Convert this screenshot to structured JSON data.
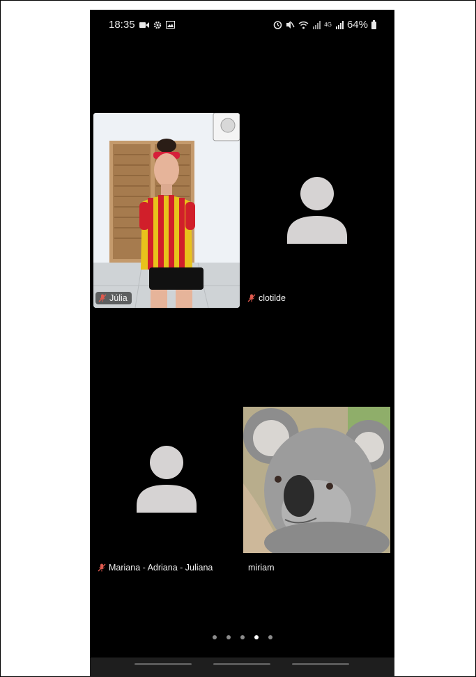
{
  "status_bar": {
    "time": "18:35",
    "battery": "64%",
    "network": "4G",
    "left_icons": [
      "video-icon",
      "gear-icon",
      "image-icon"
    ],
    "right_icons": [
      "alarm-icon",
      "mute-icon",
      "wifi-icon",
      "signal-icon",
      "signal-4g-icon",
      "battery-icon"
    ]
  },
  "participants": [
    {
      "name": "Júlia",
      "muted": true,
      "has_video": true
    },
    {
      "name": "clotilde",
      "muted": true,
      "has_video": false
    },
    {
      "name": "Mariana - Adriana - Juliana",
      "muted": true,
      "has_video": false
    },
    {
      "name": "miriam",
      "muted": false,
      "has_video": true
    }
  ],
  "pagination": {
    "total": 5,
    "active": 4
  },
  "colors": {
    "background": "#000000",
    "avatar": "#d6d3d3",
    "label_text": "#f2f2f2"
  }
}
